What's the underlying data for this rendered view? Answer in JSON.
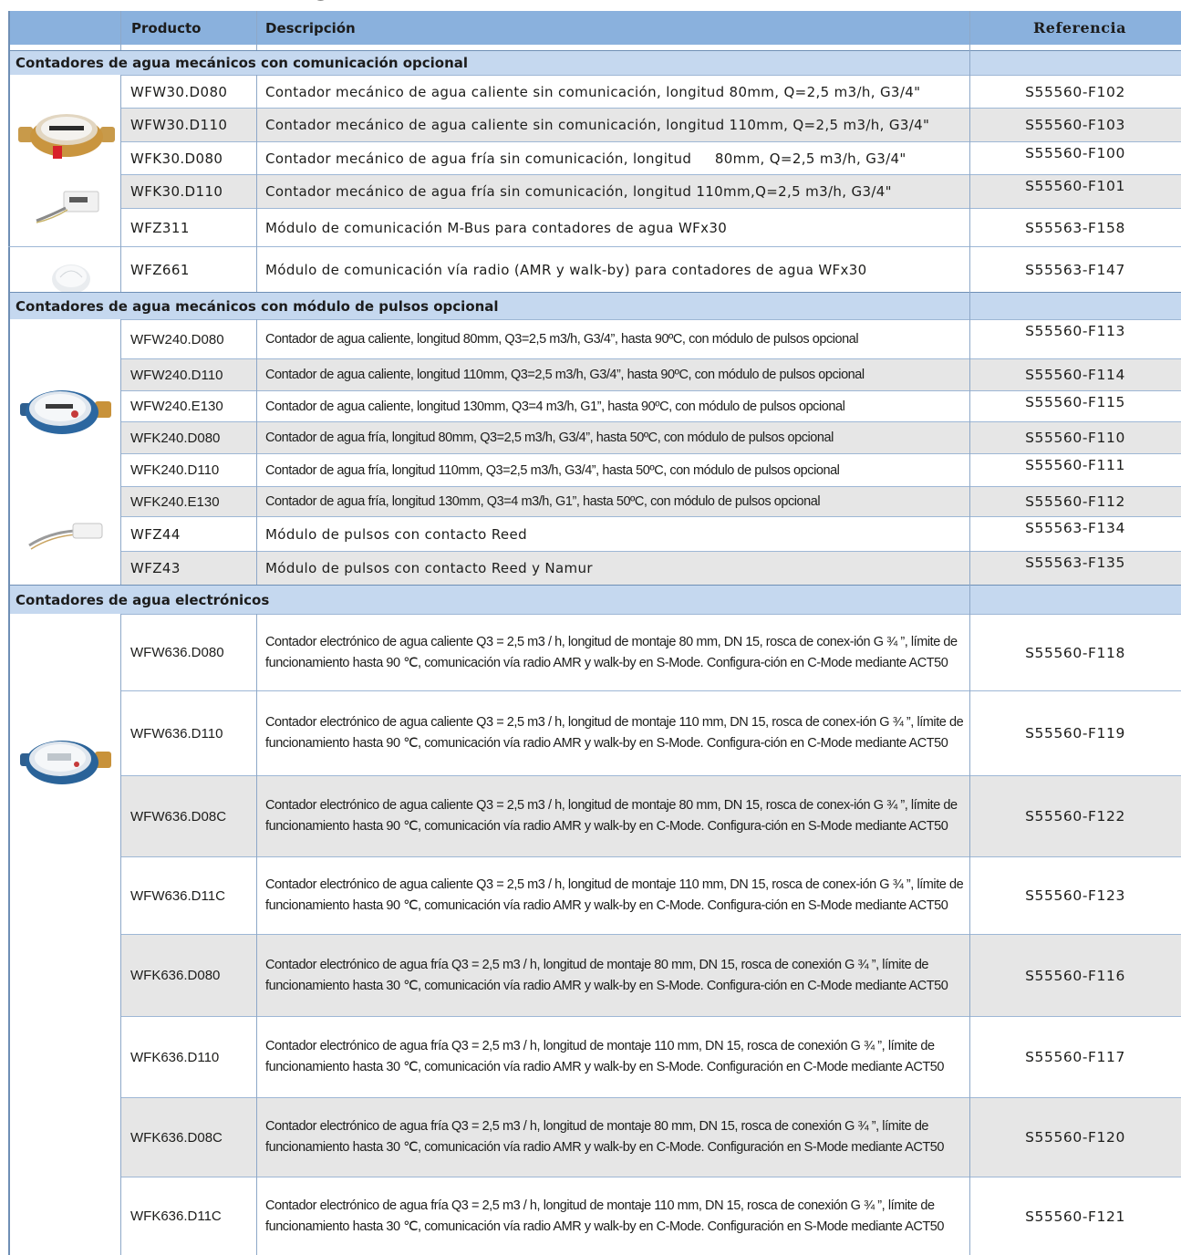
{
  "table": {
    "headers": {
      "producto": "Producto",
      "descripcion": "Descripción",
      "referencia": "Referencia"
    },
    "sections": [
      {
        "title": "Contadores de agua mecánicos con comunicación opcional",
        "rows": [
          {
            "producto": "WFW30.D080",
            "descripcion": "Contador mecánico de agua caliente sin comunicación, longitud 80mm, Q=2,5 m3/h, G3/4\"",
            "referencia": "S55560-F102"
          },
          {
            "producto": "WFW30.D110",
            "descripcion": "Contador mecánico de agua caliente sin comunicación, longitud 110mm, Q=2,5 m3/h, G3/4\"",
            "referencia": "S55560-F103"
          },
          {
            "producto": "WFK30.D080",
            "descripcion": "Contador mecánico de agua fría sin comunicación, longitud     80mm, Q=2,5 m3/h, G3/4\"",
            "referencia": "S55560-F100"
          },
          {
            "producto": "WFK30.D110",
            "descripcion": "Contador mecánico de agua fría sin comunicación, longitud 110mm,Q=2,5 m3/h, G3/4\"",
            "referencia": "S55560-F101"
          },
          {
            "producto": "WFZ311",
            "descripcion": "Módulo de comunicación M-Bus para contadores de agua WFx30",
            "referencia": "S55563-F158"
          },
          {
            "producto": "WFZ661",
            "descripcion": "Módulo de comunicación vía radio (AMR y walk-by) para contadores de agua WFx30",
            "referencia": "S55563-F147"
          }
        ]
      },
      {
        "title": "Contadores de agua mecánicos con módulo de pulsos opcional",
        "rows": [
          {
            "producto": "WFW240.D080",
            "descripcion": "Contador de agua caliente, longitud 80mm, Q3=2,5 m3/h, G3/4”, hasta 90ºC, con  módulo de pulsos opcional",
            "referencia": "S55560-F113"
          },
          {
            "producto": "WFW240.D110",
            "descripcion": "Contador de agua caliente, longitud 110mm, Q3=2,5 m3/h, G3/4”, hasta 90ºC, con  módulo de pulsos opcional",
            "referencia": "S55560-F114"
          },
          {
            "producto": "WFW240.E130",
            "descripcion": "Contador de agua caliente, longitud 130mm, Q3=4 m3/h, G1”, hasta 90ºC, con  módulo de pulsos opcional",
            "referencia": "S55560-F115"
          },
          {
            "producto": "WFK240.D080",
            "descripcion": "Contador de agua fría, longitud 80mm, Q3=2,5 m3/h, G3/4”, hasta 50ºC, con  módulo de pulsos opcional",
            "referencia": "S55560-F110"
          },
          {
            "producto": "WFK240.D110",
            "descripcion": "Contador de agua fría, longitud 110mm, Q3=2,5 m3/h, G3/4”, hasta 50ºC, con  módulo de pulsos opcional",
            "referencia": "S55560-F111"
          },
          {
            "producto": "WFK240.E130",
            "descripcion": "Contador de agua fría, longitud 130mm, Q3=4 m3/h, G1”, hasta 50ºC, con módulo  de pulsos opcional",
            "referencia": "S55560-F112"
          },
          {
            "producto": "WFZ44",
            "descripcion": "Módulo de pulsos con contacto Reed",
            "referencia": "S55563-F134"
          },
          {
            "producto": "WFZ43",
            "descripcion": "Módulo de pulsos con contacto Reed y Namur",
            "referencia": "S55563-F135"
          }
        ]
      },
      {
        "title": "Contadores de agua electrónicos",
        "rows": [
          {
            "producto": "WFW636.D080",
            "descripcion": "Contador electrónico de agua caliente Q3 = 2,5 m3 / h, longitud de montaje 80 mm, DN 15, rosca de conex-ión G ¾ ”, límite de funcionamiento hasta 90 ℃, comunicación vía radio AMR y walk-by en S-Mode. Configura-ción en C-Mode mediante ACT50",
            "referencia": "S55560-F118"
          },
          {
            "producto": "WFW636.D110",
            "descripcion": "Contador electrónico de agua caliente Q3 = 2,5 m3 / h, longitud de montaje 110 mm, DN 15, rosca de conex-ión G ¾ ”, límite de funcionamiento hasta 90 ℃, comunicación vía radio AMR y walk-by en S-Mode. Configura-ción en C-Mode mediante ACT50",
            "referencia": "S55560-F119"
          },
          {
            "producto": "WFW636.D08C",
            "descripcion": "Contador electrónico de agua caliente Q3 = 2,5 m3 / h, longitud de montaje 80 mm, DN 15, rosca de conex-ión G ¾ ”, límite de funcionamiento hasta 90 ℃, comunicación vía radio AMR y walk-by en C-Mode. Configura-ción en S-Mode mediante ACT50",
            "referencia": "S55560-F122"
          },
          {
            "producto": "WFW636.D11C",
            "descripcion": "Contador electrónico de agua caliente Q3 = 2,5 m3 / h, longitud de montaje 110 mm, DN 15, rosca de conex-ión G ¾ ”, límite de funcionamiento hasta 90 ℃, comunicación vía radio AMR y walk-by en C-Mode. Configura-ción en S-Mode mediante ACT50",
            "referencia": "S55560-F123"
          },
          {
            "producto": "WFK636.D080",
            "descripcion": "Contador electrónico de agua fría Q3 = 2,5 m3 / h, longitud de montaje 80 mm, DN 15, rosca de conexión G ¾ ”, límite de funcionamiento hasta 30 ℃, comunicación vía radio AMR y walk-by en S-Mode. Configura-ción en C-Mode mediante ACT50",
            "referencia": "S55560-F116"
          },
          {
            "producto": "WFK636.D110",
            "descripcion": "Contador electrónico de agua fría Q3 = 2,5 m3 / h, longitud de montaje 110 mm, DN 15, rosca de conexión G ¾ ”, límite de funcionamiento hasta 30 ℃, comunicación vía radio AMR y walk-by en S-Mode. Configuración en C-Mode mediante ACT50",
            "referencia": "S55560-F117"
          },
          {
            "producto": "WFK636.D08C",
            "descripcion": "Contador electrónico de agua fría Q3 = 2,5 m3 / h, longitud de montaje 80 mm, DN 15, rosca de conexión G ¾ ”, límite de funcionamiento hasta 30 ℃, comunicación vía radio AMR y walk-by en C-Mode. Configuración en S-Mode mediante ACT50",
            "referencia": "S55560-F120"
          },
          {
            "producto": "WFK636.D11C",
            "descripcion": "Contador electrónico de agua fría Q3 = 2,5 m3 / h, longitud de montaje 110 mm, DN 15, rosca de conexión G ¾ ”, límite de funcionamiento hasta 30 ℃, comunicación vía radio AMR y walk-by en C-Mode. Configuración en S-Mode mediante ACT50",
            "referencia": "S55560-F121"
          }
        ]
      }
    ]
  },
  "images": {
    "s1_meter": "mechanical-water-meter-image",
    "s1_mbus": "m-bus-module-image",
    "s1_radio": "radio-module-image",
    "s2_meter": "blue-water-meter-image",
    "s2_pulse": "pulse-module-cable-image",
    "s3_meter": "electronic-water-meter-image"
  },
  "colors": {
    "header": "#8ab1dd",
    "section": "#c5d8ef",
    "row_alt": "#e6e6e6"
  }
}
